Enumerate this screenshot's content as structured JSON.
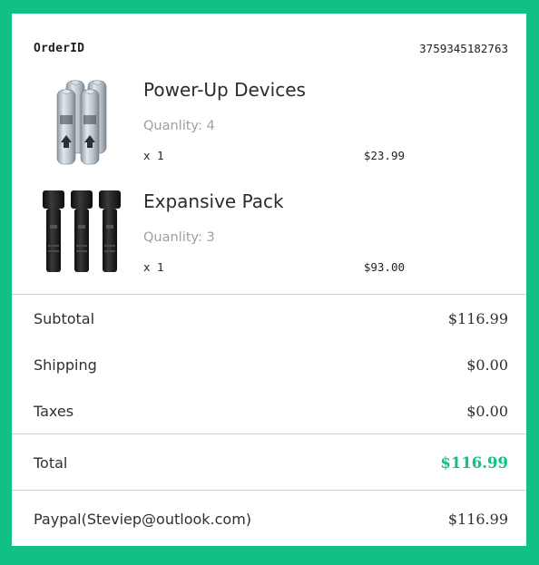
{
  "order": {
    "label": "OrderID",
    "id": "3759345182763"
  },
  "items": [
    {
      "name": "Power-Up Devices",
      "quantity_text": "Quanlity: 4",
      "multiplier": "x 1",
      "price": "$23.99",
      "thumb_icon": "battery-pack-icon"
    },
    {
      "name": "Expansive Pack",
      "quantity_text": "Quanlity: 3",
      "multiplier": "x 1",
      "price": "$93.00",
      "thumb_icon": "flashlight-pack-icon"
    }
  ],
  "summary": {
    "subtotal_label": "Subtotal",
    "subtotal_value": "$116.99",
    "shipping_label": "Shipping",
    "shipping_value": "$0.00",
    "taxes_label": "Taxes",
    "taxes_value": "$0.00",
    "total_label": "Total",
    "total_value": "$116.99"
  },
  "payment": {
    "method": "Paypal(Steviep@outlook.com)",
    "amount": "$116.99"
  },
  "colors": {
    "accent": "#12bf87",
    "background": "#12bf87",
    "card": "#ffffff"
  }
}
